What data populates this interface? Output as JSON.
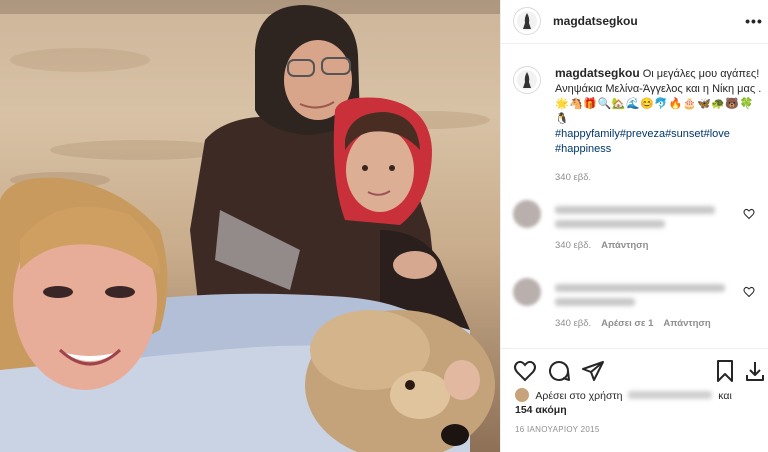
{
  "post": {
    "username": "magdatsegkou",
    "caption_text": "Οι μεγάλες μου αγάπες! Ανηψάκια Μελίνα-Άγγελος και η Νίκη μας .",
    "caption_emojis": "🌟🐴🎁🔍🏡🌊😊🐬🔥🎂🦋🐢🐻🍀🐧",
    "hashtags": "#happyfamily#preveza#sunset#love #happiness",
    "caption_time": "340 εβδ."
  },
  "comments": [
    {
      "time": "340 εβδ.",
      "reply_label": "Απάντηση",
      "likes_label": ""
    },
    {
      "time": "340 εβδ.",
      "likes_label": "Αρέσει σε 1",
      "reply_label": "Απάντηση"
    }
  ],
  "likes": {
    "prefix": "Αρέσει στο χρήστη",
    "and": "και",
    "count_text": "154 ακόμη"
  },
  "date": "16 ΙΑΝΟΥΑΡΙΟΥ 2015",
  "icons": {
    "more": "more-options-icon",
    "like": "heart-icon",
    "comment": "comment-icon",
    "share": "share-icon",
    "save": "bookmark-icon"
  },
  "colors": {
    "text": "#262626",
    "secondary": "#8e8e8e",
    "hashtag": "#00376b",
    "border": "#efefef"
  }
}
